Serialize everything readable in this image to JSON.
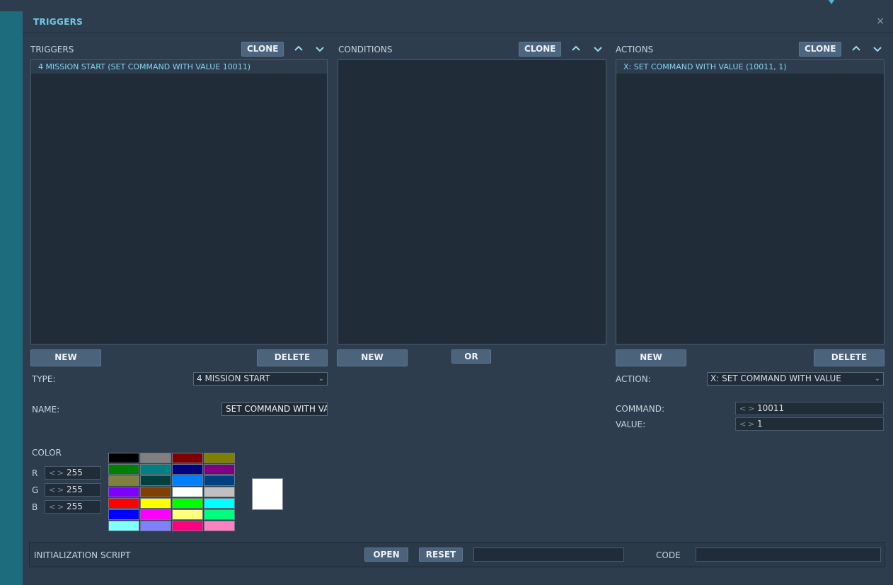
{
  "window": {
    "title": "TRIGGERS",
    "close_glyph": "×"
  },
  "top_icons": [
    "pin-icon",
    "person-icon"
  ],
  "triggers": {
    "label": "TRIGGERS",
    "clone_label": "CLONE",
    "items": [
      "4 MISSION START (SET COMMAND WITH VALUE 10011)"
    ],
    "new_label": "NEW",
    "delete_label": "DELETE",
    "type_label": "TYPE:",
    "type_value": "4 MISSION START",
    "name_label": "NAME:",
    "name_value": "SET COMMAND WITH VALU"
  },
  "conditions": {
    "label": "CONDITIONS",
    "clone_label": "CLONE",
    "items": [],
    "new_label": "NEW",
    "or_label": "OR"
  },
  "actions": {
    "label": "ACTIONS",
    "clone_label": "CLONE",
    "items": [
      "X: SET COMMAND WITH VALUE (10011, 1)"
    ],
    "new_label": "NEW",
    "delete_label": "DELETE",
    "action_label": "ACTION:",
    "action_value": "X: SET COMMAND WITH VALUE",
    "command_label": "COMMAND:",
    "command_value": "10011",
    "value_label": "VALUE:",
    "value_value": "1"
  },
  "color": {
    "label": "COLOR",
    "r_label": "R",
    "r_value": "255",
    "g_label": "G",
    "g_value": "255",
    "b_label": "B",
    "b_value": "255",
    "palette": [
      "#000000",
      "#808080",
      "#800000",
      "#808000",
      "#008000",
      "#008080",
      "#000080",
      "#800080",
      "#808040",
      "#004040",
      "#0080ff",
      "#004080",
      "#8000ff",
      "#804000",
      "#ffffff",
      "#c0c0c0",
      "#ff0000",
      "#ffff00",
      "#00ff00",
      "#00ffff",
      "#0000ff",
      "#ff00ff",
      "#ffff80",
      "#00ff80",
      "#80ffff",
      "#8080ff",
      "#ff0080",
      "#ff80c0"
    ],
    "selected": "#ffffff"
  },
  "init_script": {
    "label": "INITIALIZATION SCRIPT",
    "open_label": "OPEN",
    "reset_label": "RESET",
    "code_label": "CODE"
  }
}
